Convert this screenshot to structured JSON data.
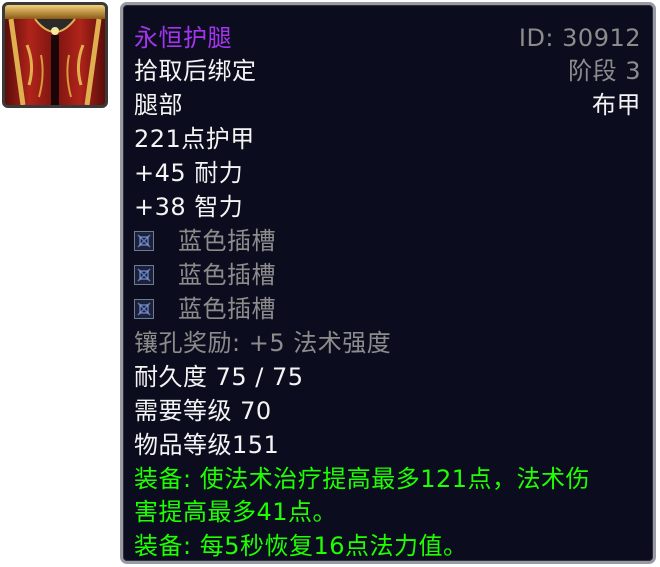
{
  "item": {
    "name": "永恒护腿",
    "id_label": "ID: 30912",
    "stage_label": "阶段 3",
    "bind": "拾取后绑定",
    "slot": "腿部",
    "armor_type": "布甲",
    "armor": "221点护甲",
    "stats": [
      "+45 耐力",
      "+38 智力"
    ],
    "sockets": [
      {
        "icon": "blue-socket-icon",
        "label": "蓝色插槽"
      },
      {
        "icon": "blue-socket-icon",
        "label": "蓝色插槽"
      },
      {
        "icon": "blue-socket-icon",
        "label": "蓝色插槽"
      }
    ],
    "socket_bonus": "镶孔奖励: +5 法术强度",
    "durability": "耐久度 75 / 75",
    "required_level": "需要等级 70",
    "item_level": "物品等级151",
    "effects": [
      "装备: 使法术治疗提高最多121点，法术伤",
      "害提高最多41点。",
      "装备: 每5秒恢复16点法力值。"
    ]
  },
  "colors": {
    "epic": "#a335ee",
    "grey": "#8c8c8c",
    "white": "#f4f4f4",
    "equip_green": "#1eff00",
    "tooltip_bg": "#0b0d1e"
  },
  "icons": {
    "item": "cloth-leggings-icon"
  }
}
